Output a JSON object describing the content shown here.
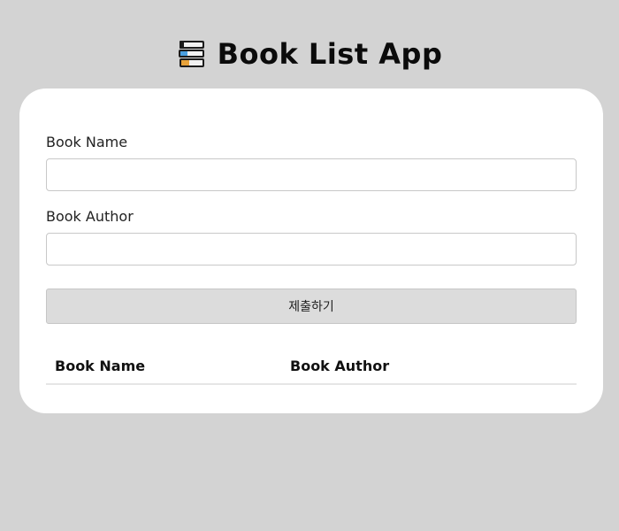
{
  "header": {
    "icon": "books-icon",
    "title": "Book List App"
  },
  "form": {
    "name_label": "Book Name",
    "name_value": "",
    "author_label": "Book Author",
    "author_value": "",
    "submit_label": "제출하기"
  },
  "table": {
    "columns": [
      "Book Name",
      "Book Author"
    ],
    "rows": []
  },
  "colors": {
    "background": "#d3d3d3",
    "card": "#ffffff",
    "button": "#dcdcdc"
  }
}
